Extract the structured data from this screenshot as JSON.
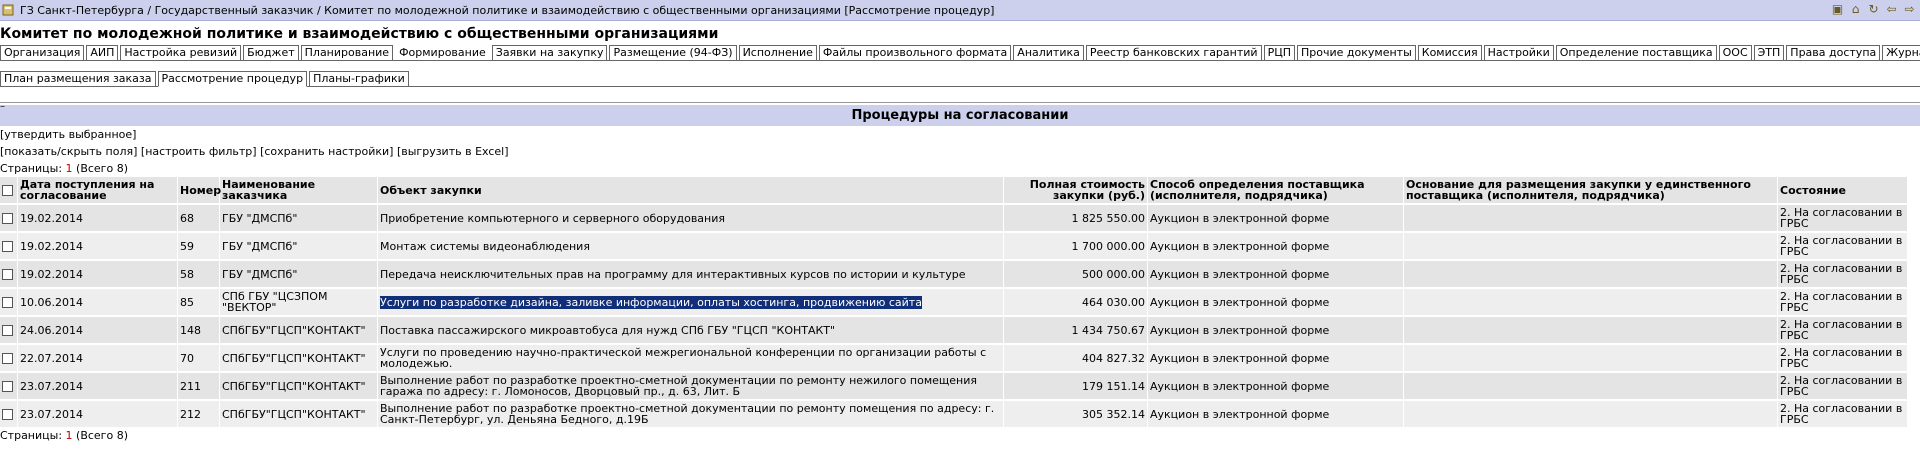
{
  "titlebar": {
    "title": "ГЗ Санкт-Петербурга / Государственный заказчик / Комитет по молодежной политике и взаимодействию с общественными организациями [Рассмотрение процедур]"
  },
  "page_title": "Комитет по молодежной политике и взаимодействию с общественными организациями",
  "tabs": [
    {
      "label": "Организация",
      "active": false
    },
    {
      "label": "АИП",
      "active": false
    },
    {
      "label": "Настройка ревизий",
      "active": false
    },
    {
      "label": "Бюджет",
      "active": false
    },
    {
      "label": "Планирование",
      "active": false
    },
    {
      "label": "Формирование",
      "active": true
    },
    {
      "label": "Заявки на закупку",
      "active": false
    },
    {
      "label": "Размещение (94-ФЗ)",
      "active": false
    },
    {
      "label": "Исполнение",
      "active": false
    },
    {
      "label": "Файлы произвольного формата",
      "active": false
    },
    {
      "label": "Аналитика",
      "active": false
    },
    {
      "label": "Реестр банковских гарантий",
      "active": false
    },
    {
      "label": "РЦП",
      "active": false
    },
    {
      "label": "Прочие документы",
      "active": false
    },
    {
      "label": "Комиссия",
      "active": false
    },
    {
      "label": "Настройки",
      "active": false
    },
    {
      "label": "Определение поставщика",
      "active": false
    },
    {
      "label": "ООС",
      "active": false
    },
    {
      "label": "ЭТП",
      "active": false
    },
    {
      "label": "Права доступа",
      "active": false
    },
    {
      "label": "Журнал",
      "active": false
    }
  ],
  "subtabs": [
    {
      "label": "План размещения заказа",
      "active": false
    },
    {
      "label": "Рассмотрение процедур",
      "active": true
    },
    {
      "label": "Планы-графики",
      "active": false
    }
  ],
  "section_title": "Процедуры на согласовании",
  "actions": {
    "approve": "[утвердить выбранное]",
    "toggle_fields": "[показать/скрыть поля]",
    "filter": "[настроить фильтр]",
    "save_settings": "[сохранить настройки]",
    "export_excel": "[выгрузить в Excel]"
  },
  "pager": {
    "label": "Страницы:",
    "current": "1",
    "total": "(Всего 8)"
  },
  "columns": [
    "Дата поступления на согласование",
    "Номер",
    "Наименование заказчика",
    "Объект закупки",
    "Полная стоимость закупки (руб.)",
    "Способ определения поставщика (исполнителя, подрядчика)",
    "Основание для размещения закупки у единственного поставщика (исполнителя, подрядчика)",
    "Состояние"
  ],
  "rows": [
    {
      "date": "19.02.2014",
      "number": "68",
      "customer": "ГБУ \"ДМСПб\"",
      "object": "Приобретение компьютерного и серверного оборудования",
      "cost": "1 825 550.00",
      "method": "Аукцион в электронной форме",
      "basis": "",
      "state": "2. На согласовании в ГРБС",
      "highlight": false
    },
    {
      "date": "19.02.2014",
      "number": "59",
      "customer": "ГБУ \"ДМСПб\"",
      "object": "Монтаж системы видеонаблюдения",
      "cost": "1 700 000.00",
      "method": "Аукцион в электронной форме",
      "basis": "",
      "state": "2. На согласовании в ГРБС",
      "highlight": false
    },
    {
      "date": "19.02.2014",
      "number": "58",
      "customer": "ГБУ \"ДМСПб\"",
      "object": "Передача неисключительных прав на программу для интерактивных курсов по истории и культуре",
      "cost": "500 000.00",
      "method": "Аукцион в электронной форме",
      "basis": "",
      "state": "2. На согласовании в ГРБС",
      "highlight": false
    },
    {
      "date": "10.06.2014",
      "number": "85",
      "customer": "СПб ГБУ \"ЦСЗПОМ \"ВЕКТОР\"",
      "object": "Услуги по разработке дизайна, заливке информации, оплаты хостинга, продвижению сайта",
      "cost": "464 030.00",
      "method": "Аукцион в электронной форме",
      "basis": "",
      "state": "2. На согласовании в ГРБС",
      "highlight": true
    },
    {
      "date": "24.06.2014",
      "number": "148",
      "customer": "СПбГБУ\"ГЦСП\"КОНТАКТ\"",
      "object": "Поставка пассажирского микроавтобуса для нужд СПб ГБУ \"ГЦСП \"КОНТАКТ\"",
      "cost": "1 434 750.67",
      "method": "Аукцион в электронной форме",
      "basis": "",
      "state": "2. На согласовании в ГРБС",
      "highlight": false
    },
    {
      "date": "22.07.2014",
      "number": "70",
      "customer": "СПбГБУ\"ГЦСП\"КОНТАКТ\"",
      "object": "Услуги по проведению научно-практической межрегиональной конференции по организации работы с молодежью.",
      "cost": "404 827.32",
      "method": "Аукцион в электронной форме",
      "basis": "",
      "state": "2. На согласовании в ГРБС",
      "highlight": false
    },
    {
      "date": "23.07.2014",
      "number": "211",
      "customer": "СПбГБУ\"ГЦСП\"КОНТАКТ\"",
      "object": "Выполнение работ по разработке проектно-сметной документации по ремонту нежилого помещения гаража по адресу: г. Ломоносов, Дворцовый пр., д. 63, Лит. Б",
      "cost": "179 151.14",
      "method": "Аукцион в электронной форме",
      "basis": "",
      "state": "2. На согласовании в ГРБС",
      "highlight": false
    },
    {
      "date": "23.07.2014",
      "number": "212",
      "customer": "СПбГБУ\"ГЦСП\"КОНТАКТ\"",
      "object": "Выполнение работ по разработке проектно-сметной документации по ремонту помещения по адресу: г. Санкт-Петербург, ул. Деньяна Бедного, д.19Б",
      "cost": "305 352.14",
      "method": "Аукцион в электронной форме",
      "basis": "",
      "state": "2. На согласовании в ГРБС",
      "highlight": false
    }
  ]
}
